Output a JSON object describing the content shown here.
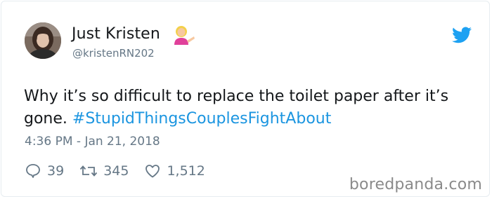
{
  "tweet": {
    "author_name": "Just Kristen",
    "author_handle": "@kristenRN202",
    "author_emoji": "person-tipping-hand",
    "text_plain": "Why it’s so difficult to replace the toilet paper after it’s gone. ",
    "hashtag": "#StupidThingsCouplesFightAbout",
    "timestamp": "4:36 PM - Jan 21, 2018",
    "replies": "39",
    "retweets": "345",
    "likes": "1,512"
  },
  "icons": {
    "brand": "twitter-bird-icon",
    "reply": "reply-icon",
    "retweet": "retweet-icon",
    "like": "heart-icon"
  },
  "colors": {
    "twitter_blue": "#1da1f2",
    "hashtag": "#1b95e0",
    "muted": "#657786"
  },
  "watermark": "boredpanda.com"
}
